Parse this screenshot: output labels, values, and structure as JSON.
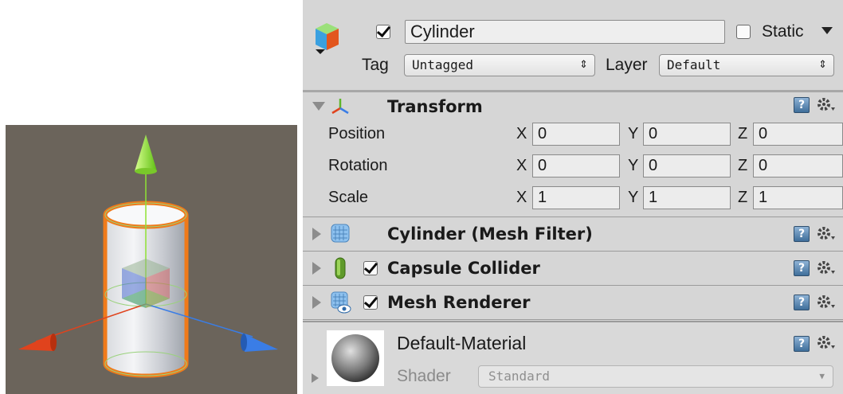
{
  "scene": {
    "colors": {
      "background": "#6b645b",
      "y_axis": "#8fe235",
      "x_axis": "#e0431d",
      "z_axis": "#3a7de6",
      "selection": "#f07a1a"
    }
  },
  "inspector": {
    "object_name": "Cylinder",
    "active": true,
    "static_label": "Static",
    "static_checked": false,
    "tag_label": "Tag",
    "tag_value": "Untagged",
    "layer_label": "Layer",
    "layer_value": "Default",
    "transform": {
      "title": "Transform",
      "rows": [
        {
          "label": "Position",
          "x": "0",
          "y": "0",
          "z": "0"
        },
        {
          "label": "Rotation",
          "x": "0",
          "y": "0",
          "z": "0"
        },
        {
          "label": "Scale",
          "x": "1",
          "y": "1",
          "z": "1"
        }
      ],
      "axis_x": "X",
      "axis_y": "Y",
      "axis_z": "Z"
    },
    "components": [
      {
        "title": "Cylinder (Mesh Filter)",
        "checkbox": false,
        "icon": "mesh-filter-icon"
      },
      {
        "title": "Capsule Collider",
        "checkbox": true,
        "icon": "capsule-collider-icon"
      },
      {
        "title": "Mesh Renderer",
        "checkbox": true,
        "icon": "mesh-renderer-icon"
      }
    ],
    "material": {
      "name": "Default-Material",
      "shader_label": "Shader",
      "shader_value": "Standard"
    },
    "help_glyph": "?"
  }
}
